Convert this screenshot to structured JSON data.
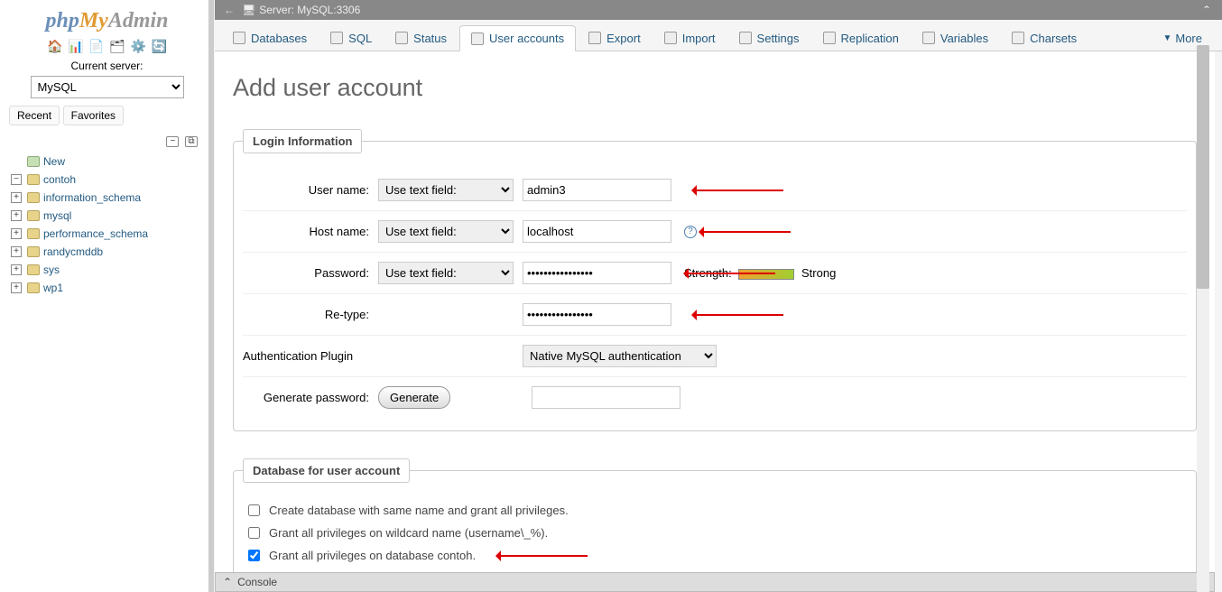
{
  "logo_parts": [
    "php",
    "My",
    "Admin"
  ],
  "sidebar": {
    "current_server_label": "Current server:",
    "server_select": "MySQL",
    "recent_btn": "Recent",
    "favorites_btn": "Favorites",
    "tree": [
      {
        "label": "New",
        "new": true,
        "pm": ""
      },
      {
        "label": "contoh",
        "pm": "−"
      },
      {
        "label": "information_schema",
        "pm": "+"
      },
      {
        "label": "mysql",
        "pm": "+"
      },
      {
        "label": "performance_schema",
        "pm": "+"
      },
      {
        "label": "randycmddb",
        "pm": "+"
      },
      {
        "label": "sys",
        "pm": "+"
      },
      {
        "label": "wp1",
        "pm": "+"
      }
    ]
  },
  "topbar": {
    "server_label": "Server: MySQL:3306"
  },
  "tabs": [
    {
      "label": "Databases"
    },
    {
      "label": "SQL"
    },
    {
      "label": "Status"
    },
    {
      "label": "User accounts",
      "active": true
    },
    {
      "label": "Export"
    },
    {
      "label": "Import"
    },
    {
      "label": "Settings"
    },
    {
      "label": "Replication"
    },
    {
      "label": "Variables"
    },
    {
      "label": "Charsets"
    }
  ],
  "tabs_more": "More",
  "page": {
    "title": "Add user account",
    "login_legend": "Login Information",
    "rows": {
      "username_label": "User name:",
      "username_mode": "Use text field:",
      "username_value": "admin3",
      "hostname_label": "Host name:",
      "hostname_mode": "Use text field:",
      "hostname_value": "localhost",
      "password_label": "Password:",
      "password_mode": "Use text field:",
      "password_value": "••••••••••••••••",
      "strength_prefix": "Strength:",
      "strength_label": "Strong",
      "retype_label": "Re-type:",
      "retype_value": "••••••••••••••••",
      "auth_label": "Authentication Plugin",
      "auth_value": "Native MySQL authentication",
      "gen_label": "Generate password:",
      "gen_btn": "Generate"
    },
    "dbacct_legend": "Database for user account",
    "dbacct_opts": [
      {
        "label": "Create database with same name and grant all privileges.",
        "checked": false
      },
      {
        "label": "Grant all privileges on wildcard name (username\\_%).",
        "checked": false
      },
      {
        "label": "Grant all privileges on database contoh.",
        "checked": true
      }
    ]
  },
  "console_label": "Console"
}
